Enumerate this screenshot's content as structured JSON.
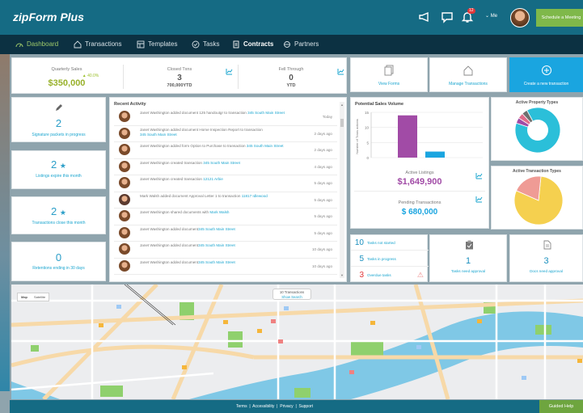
{
  "app": {
    "logo": "zipForm Plus",
    "notifications_count": "12",
    "me_label": "Me",
    "schedule_button": "Schedule a Meeting"
  },
  "nav": [
    {
      "label": "Dashboard",
      "icon": "dashboard-icon",
      "active": true
    },
    {
      "label": "Transactions",
      "icon": "home-icon"
    },
    {
      "label": "Templates",
      "icon": "templates-icon"
    },
    {
      "label": "Tasks",
      "icon": "tasks-icon"
    },
    {
      "label": "Contracts",
      "icon": "contracts-icon",
      "bold": true
    },
    {
      "label": "Partners",
      "icon": "partners-icon"
    }
  ],
  "stats": {
    "quarterly_sales": {
      "label": "Quarterly Sales",
      "value": "$350,000",
      "change": "40.0%"
    },
    "closed_txns": {
      "label": "Closed Txns",
      "value": "3",
      "sub": "700,000",
      "sub_suffix": "YTD"
    },
    "fell_through": {
      "label": "Fell Through",
      "value": "0",
      "sub": "YTD"
    }
  },
  "actions": {
    "view_forms": "View Forms",
    "manage_transactions": "Manage Transactions",
    "create_transaction": "Create a new transaction"
  },
  "left_cards": [
    {
      "value": "2",
      "label": "Signature packets in progress",
      "icon": "pen-icon"
    },
    {
      "value": "2",
      "label": "Listings expire this month",
      "star": true
    },
    {
      "value": "2",
      "label": "Transactions close this month",
      "star": true
    },
    {
      "value": "0",
      "label": "Retentions ending in 30 days"
    }
  ],
  "recent_activity": {
    "title": "Recent Activity",
    "items": [
      {
        "text": "Janet Washington added document 125 handoutgr to transaction ",
        "link": "345 South Main Street",
        "when": "Today"
      },
      {
        "text": "Janet Washington added document Home Inspection Report to transaction",
        "link": "345 South Main Street",
        "when": "2 days ago"
      },
      {
        "text": "Janet Washington added form Option to Purchase to transaction ",
        "link": "345 South Main Street",
        "when": "2 days ago"
      },
      {
        "text": "Janet Washington created transaction ",
        "link": "345 South Main Street",
        "when": "4 days ago"
      },
      {
        "text": "Janet Washington created transaction ",
        "link": "12121 Arbie",
        "when": "5 days ago"
      },
      {
        "text": "Mark Walsh added document Approval Letter 1 to transaction ",
        "link": "11817 Idlewood",
        "when": "5 days ago"
      },
      {
        "text": "Janet Washington shared documents with ",
        "link": "Mark Walsh",
        "when": "5 days ago"
      },
      {
        "text": "Janet Washington added document",
        "link": "345 South Main Street",
        "when": "5 days ago"
      },
      {
        "text": "Janet Washington added document",
        "link": "345 South Main Street",
        "when": "10 days ago"
      },
      {
        "text": "Janet Washington added document",
        "link": "345 South Main Street",
        "when": "10 days ago"
      }
    ]
  },
  "sales_volume": {
    "title": "Potential Sales Volume",
    "active_listings_label": "Active Listings",
    "active_listings_value": "$1,649,900",
    "pending_label": "Pending Transactions",
    "pending_value": "$ 680,000"
  },
  "chart_data": [
    {
      "type": "bar",
      "title": "",
      "ylabel": "Number of Trans actions",
      "categories": [
        "Active Listings",
        "Pending Transactions"
      ],
      "values": [
        14,
        2
      ],
      "ylim": [
        0,
        15
      ],
      "yticks": [
        0,
        5,
        10,
        15
      ],
      "colors": [
        "#a14ba6",
        "#1aa5e0"
      ]
    },
    {
      "type": "pie",
      "title": "Active Property Types",
      "values": [
        88,
        4,
        4,
        4
      ],
      "colors": [
        "#2bbfd9",
        "#a14ba6",
        "#e06b8a",
        "#6f6f6f"
      ]
    },
    {
      "type": "pie",
      "title": "Active Transaction Types",
      "values": [
        80,
        20
      ],
      "colors": [
        "#f5d04f",
        "#ef9b95"
      ]
    }
  ],
  "tasks": [
    {
      "value": "10",
      "label": "Tasks not started"
    },
    {
      "value": "5",
      "label": "Tasks in progress"
    },
    {
      "value": "3",
      "label": "Overdue tasks"
    }
  ],
  "approvals": {
    "tasks": {
      "value": "1",
      "label": "Tasks need approval"
    },
    "docs": {
      "value": "3",
      "label": "Docs need approval"
    }
  },
  "map": {
    "pill_line1": "10 Transactions",
    "pill_line2": "Show Search",
    "type_map": "Map",
    "type_sat": "Satellite"
  },
  "footer": {
    "links": [
      "Terms",
      "Accessibility",
      "Privacy",
      "Support"
    ],
    "guided_help": "Guided Help"
  }
}
